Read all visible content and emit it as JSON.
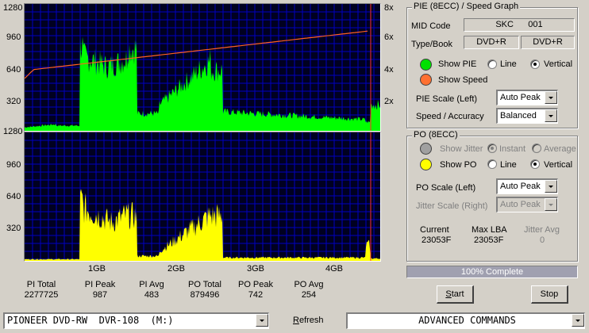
{
  "pie_graph": {
    "y_ticks": [
      "1280",
      "960",
      "640",
      "320"
    ],
    "speed_ticks": [
      "8x",
      "6x",
      "4x",
      "2x"
    ]
  },
  "po_graph": {
    "y_ticks": [
      "1280",
      "960",
      "640",
      "320"
    ]
  },
  "x_axis": {
    "ticks": [
      "1GB",
      "2GB",
      "3GB",
      "4GB"
    ]
  },
  "stats": [
    {
      "label": "PI Total",
      "value": "2277725"
    },
    {
      "label": "PI Peak",
      "value": "987"
    },
    {
      "label": "PI Avg",
      "value": "483"
    },
    {
      "label": "PO Total",
      "value": "879496"
    },
    {
      "label": "PO Peak",
      "value": "742"
    },
    {
      "label": "PO Avg",
      "value": "254"
    }
  ],
  "pie_panel": {
    "title": "PIE (8ECC) / Speed Graph",
    "mid_label": "MID Code",
    "mid_value": "SKC      001",
    "type_label": "Type/Book",
    "type_value": "DVD+R",
    "book_value": "DVD+R",
    "show_pie": "Show PIE",
    "line": "Line",
    "vertical": "Vertical",
    "show_speed": "Show Speed",
    "scale_label": "PIE Scale (Left)",
    "scale_value": "Auto Peak",
    "speed_label": "Speed / Accuracy",
    "speed_value": "Balanced"
  },
  "po_panel": {
    "title": "PO (8ECC)",
    "show_jitter": "Show Jitter",
    "instant": "Instant",
    "average": "Average",
    "show_po": "Show PO",
    "line": "Line",
    "vertical": "Vertical",
    "scale_label": "PO Scale (Left)",
    "scale_value": "Auto Peak",
    "jitter_label": "Jitter Scale (Right)",
    "jitter_value": "Auto Peak",
    "current_label": "Current",
    "current_value": "23053F",
    "maxlba_label": "Max LBA",
    "maxlba_value": "23053F",
    "jitter_avg_label": "Jitter Avg",
    "jitter_avg_value": "0"
  },
  "progress": {
    "text": "100% Complete",
    "percent": 100
  },
  "buttons": {
    "start_pre": "",
    "start_u": "S",
    "start_post": "tart",
    "stop": "Stop"
  },
  "bottom": {
    "drive": "PIONEER DVD-RW  DVR-108  (M:)",
    "refresh_u": "R",
    "refresh_rest": "efresh",
    "commands": "ADVANCED COMMANDS"
  },
  "colors": {
    "pie": "#00ff00",
    "po": "#ffff00",
    "speed": "#ff6020",
    "grid": "#0000c0",
    "bg": "#000020",
    "led_pie": "#00e000",
    "led_speed": "#ff7030",
    "led_po": "#ffff00"
  }
}
